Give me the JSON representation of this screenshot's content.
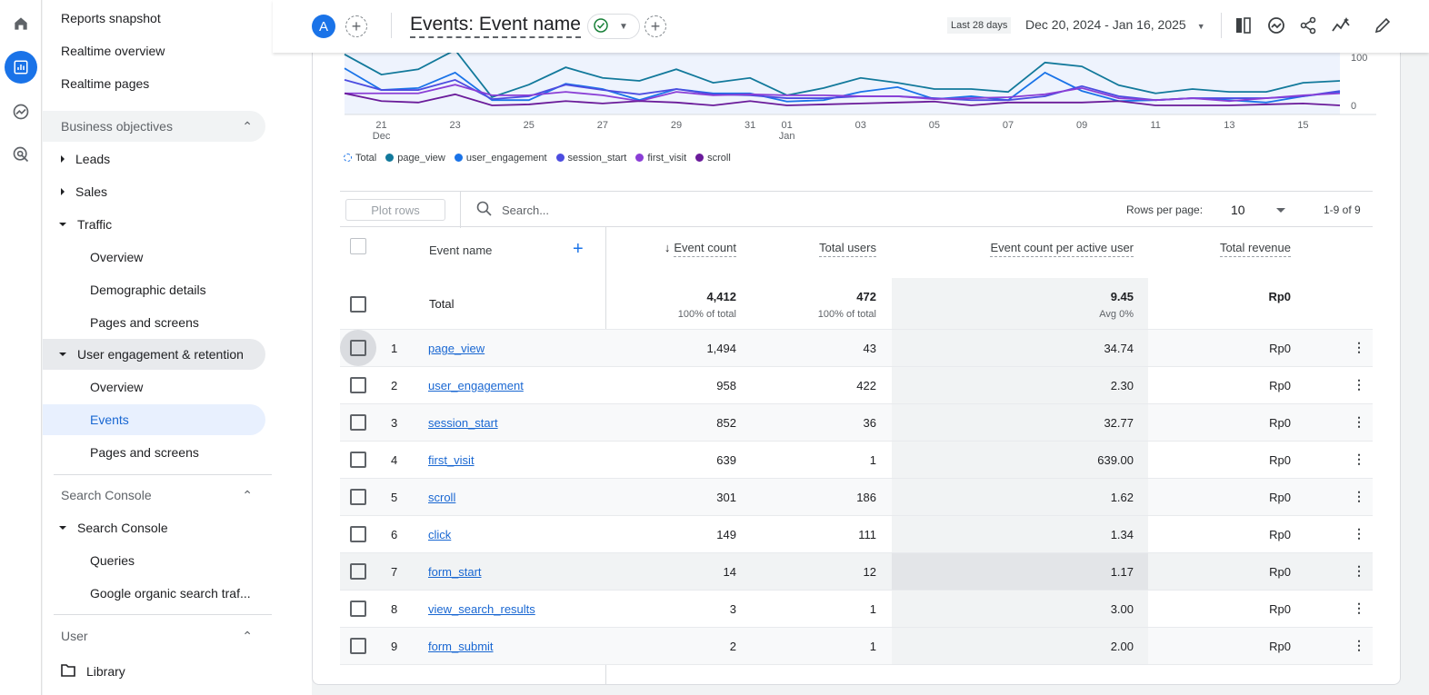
{
  "rail": {
    "icons": [
      "home-icon",
      "reports-icon",
      "explore-icon",
      "advertising-icon"
    ]
  },
  "sidebar": {
    "top_items": [
      "Reports snapshot",
      "Realtime overview",
      "Realtime pages"
    ],
    "business_objectives": "Business objectives",
    "leads": "Leads",
    "sales": "Sales",
    "traffic": "Traffic",
    "traffic_children": [
      "Overview",
      "Demographic details",
      "Pages and screens"
    ],
    "user_engagement": "User engagement & retention",
    "ue_children": [
      "Overview",
      "Events",
      "Pages and screens"
    ],
    "search_console_section": "Search Console",
    "search_console": "Search Console",
    "sc_children": [
      "Queries",
      "Google organic search traf..."
    ],
    "user_section": "User",
    "library": "Library"
  },
  "header": {
    "avatar": "A",
    "title": "Events: Event name",
    "date_label": "Last 28 days",
    "date_range": "Dec 20, 2024 - Jan 16, 2025"
  },
  "chart_data": {
    "type": "line",
    "x": [
      "Dec 20",
      "Dec 21",
      "Dec 22",
      "Dec 23",
      "Dec 24",
      "Dec 25",
      "Dec 26",
      "Dec 27",
      "Dec 28",
      "Dec 29",
      "Dec 30",
      "Dec 31",
      "Jan 01",
      "Jan 02",
      "Jan 03",
      "Jan 04",
      "Jan 05",
      "Jan 06",
      "Jan 07",
      "Jan 08",
      "Jan 09",
      "Jan 10",
      "Jan 11",
      "Jan 12",
      "Jan 13",
      "Jan 14",
      "Jan 15",
      "Jan 16"
    ],
    "xtick_labels": [
      {
        "d": "21",
        "m": "Dec",
        "i": 1
      },
      {
        "d": "23",
        "i": 3
      },
      {
        "d": "25",
        "i": 5
      },
      {
        "d": "27",
        "i": 7
      },
      {
        "d": "29",
        "i": 9
      },
      {
        "d": "31",
        "i": 11
      },
      {
        "d": "01",
        "m": "Jan",
        "i": 12
      },
      {
        "d": "03",
        "i": 14
      },
      {
        "d": "05",
        "i": 16
      },
      {
        "d": "07",
        "i": 18
      },
      {
        "d": "09",
        "i": 20
      },
      {
        "d": "11",
        "i": 22
      },
      {
        "d": "13",
        "i": 24
      },
      {
        "d": "15",
        "i": 26
      }
    ],
    "yticks": [
      "0",
      "100"
    ],
    "ylim": [
      0,
      100
    ],
    "series": [
      {
        "name": "page_view",
        "color": "#12799b",
        "values": [
          106,
          64,
          75,
          115,
          17,
          43,
          79,
          57,
          51,
          75,
          47,
          57,
          21,
          36,
          57,
          47,
          34,
          34,
          28,
          89,
          81,
          42,
          25,
          34,
          28,
          28,
          47,
          51
        ]
      },
      {
        "name": "user_engagement",
        "color": "#1a73e8",
        "values": [
          77,
          32,
          36,
          68,
          11,
          11,
          45,
          34,
          11,
          34,
          25,
          25,
          8,
          11,
          28,
          38,
          13,
          19,
          11,
          68,
          30,
          9,
          11,
          15,
          11,
          6,
          19,
          28
        ]
      },
      {
        "name": "session_start",
        "color": "#4c4ce0",
        "values": [
          53,
          32,
          32,
          53,
          13,
          19,
          43,
          32,
          23,
          34,
          23,
          21,
          15,
          15,
          19,
          19,
          15,
          11,
          11,
          19,
          40,
          19,
          11,
          15,
          15,
          15,
          19,
          30
        ]
      },
      {
        "name": "first_visit",
        "color": "#8a3ed6",
        "values": [
          25,
          25,
          25,
          43,
          21,
          21,
          28,
          21,
          9,
          28,
          21,
          23,
          21,
          21,
          19,
          19,
          13,
          15,
          17,
          23,
          36,
          15,
          11,
          15,
          9,
          15,
          21,
          25
        ]
      },
      {
        "name": "scroll",
        "color": "#6a1b9a",
        "values": [
          25,
          9,
          6,
          23,
          0,
          2,
          9,
          4,
          9,
          6,
          0,
          9,
          0,
          2,
          4,
          6,
          8,
          0,
          6,
          6,
          6,
          9,
          0,
          0,
          0,
          2,
          4,
          0
        ]
      }
    ],
    "legend": [
      "Total",
      "page_view",
      "user_engagement",
      "session_start",
      "first_visit",
      "scroll"
    ],
    "legend_colors": [
      "#1a73e8",
      "#12799b",
      "#1a73e8",
      "#4c4ce0",
      "#8a3ed6",
      "#6a1b9a"
    ],
    "legend_placement": "bottom-left"
  },
  "table": {
    "plot_rows": "Plot rows",
    "search_placeholder": "Search...",
    "rows_per_page_label": "Rows per page:",
    "rows_per_page": "10",
    "pagination": "1-9 of 9",
    "columns": [
      "Event name",
      "Event count",
      "Total users",
      "Event count per active user",
      "Total revenue"
    ],
    "total": {
      "label": "Total",
      "event_count": "4,412",
      "event_count_sub": "100% of total",
      "total_users": "472",
      "total_users_sub": "100% of total",
      "per_user": "9.45",
      "per_user_sub": "Avg 0%",
      "revenue": "Rp0"
    },
    "rows": [
      {
        "n": "1",
        "name": "page_view",
        "count": "1,494",
        "users": "43",
        "per": "34.74",
        "rev": "Rp0"
      },
      {
        "n": "2",
        "name": "user_engagement",
        "count": "958",
        "users": "422",
        "per": "2.30",
        "rev": "Rp0"
      },
      {
        "n": "3",
        "name": "session_start",
        "count": "852",
        "users": "36",
        "per": "32.77",
        "rev": "Rp0"
      },
      {
        "n": "4",
        "name": "first_visit",
        "count": "639",
        "users": "1",
        "per": "639.00",
        "rev": "Rp0"
      },
      {
        "n": "5",
        "name": "scroll",
        "count": "301",
        "users": "186",
        "per": "1.62",
        "rev": "Rp0"
      },
      {
        "n": "6",
        "name": "click",
        "count": "149",
        "users": "111",
        "per": "1.34",
        "rev": "Rp0"
      },
      {
        "n": "7",
        "name": "form_start",
        "count": "14",
        "users": "12",
        "per": "1.17",
        "rev": "Rp0"
      },
      {
        "n": "8",
        "name": "view_search_results",
        "count": "3",
        "users": "1",
        "per": "3.00",
        "rev": "Rp0"
      },
      {
        "n": "9",
        "name": "form_submit",
        "count": "2",
        "users": "1",
        "per": "2.00",
        "rev": "Rp0"
      }
    ]
  }
}
